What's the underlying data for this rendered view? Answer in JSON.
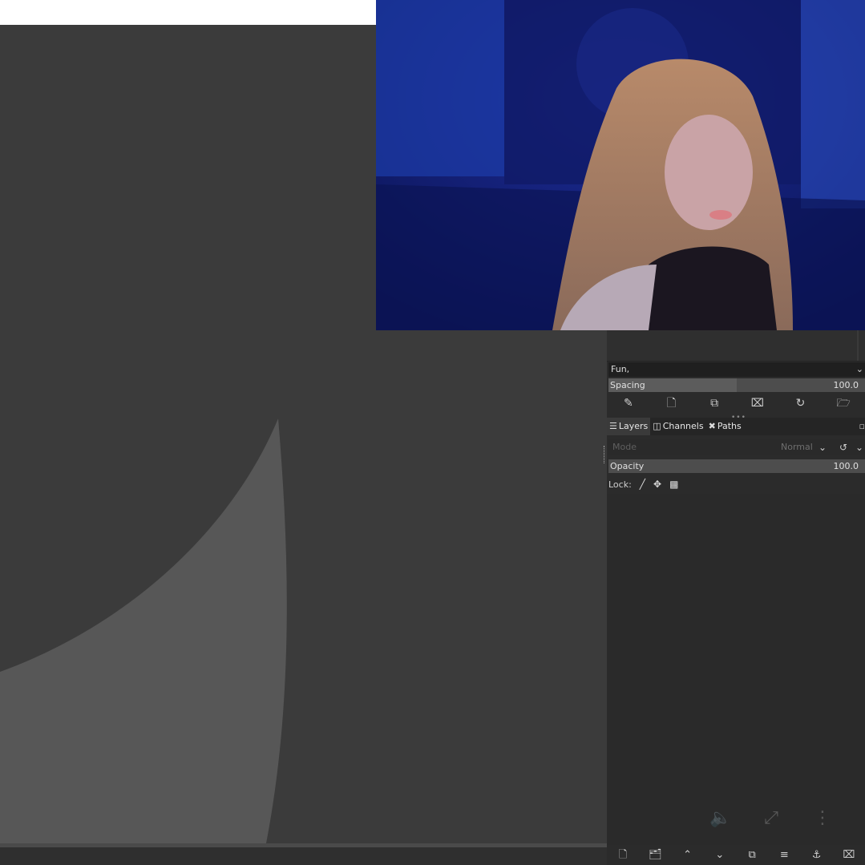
{
  "brushes": {
    "selected": "Fun,",
    "spacing_label": "Spacing",
    "spacing_value": "100.0",
    "spacing_fraction": 0.5,
    "tool_icons": [
      "edit-brush-icon",
      "new-brush-icon",
      "duplicate-brush-icon",
      "delete-brush-icon",
      "refresh-icon",
      "open-folder-icon"
    ]
  },
  "dock": {
    "tabs": [
      {
        "label": "Layers",
        "icon": "layers-icon"
      },
      {
        "label": "Channels",
        "icon": "channels-icon"
      },
      {
        "label": "Paths",
        "icon": "paths-icon"
      }
    ]
  },
  "layers": {
    "mode_label": "Mode",
    "mode_value": "Normal",
    "opacity_label": "Opacity",
    "opacity_value": "100.0",
    "lock_label": "Lock:",
    "lock_icons": [
      "lock-pixels-icon",
      "lock-position-icon",
      "lock-alpha-icon"
    ],
    "bottom_icons": [
      "new-layer-icon",
      "new-layer-group-icon",
      "raise-layer-icon",
      "lower-layer-icon",
      "duplicate-layer-icon",
      "merge-layer-icon",
      "anchor-layer-icon",
      "delete-layer-icon"
    ]
  },
  "overlay": {
    "icons": [
      "volume-icon",
      "exit-fullscreen-icon",
      "more-vert-icon"
    ]
  },
  "colors": {
    "canvas_bg": "#3b3b3b",
    "panel_bg": "#2b2b2b",
    "webcam_bg": "#0e1a6a"
  }
}
